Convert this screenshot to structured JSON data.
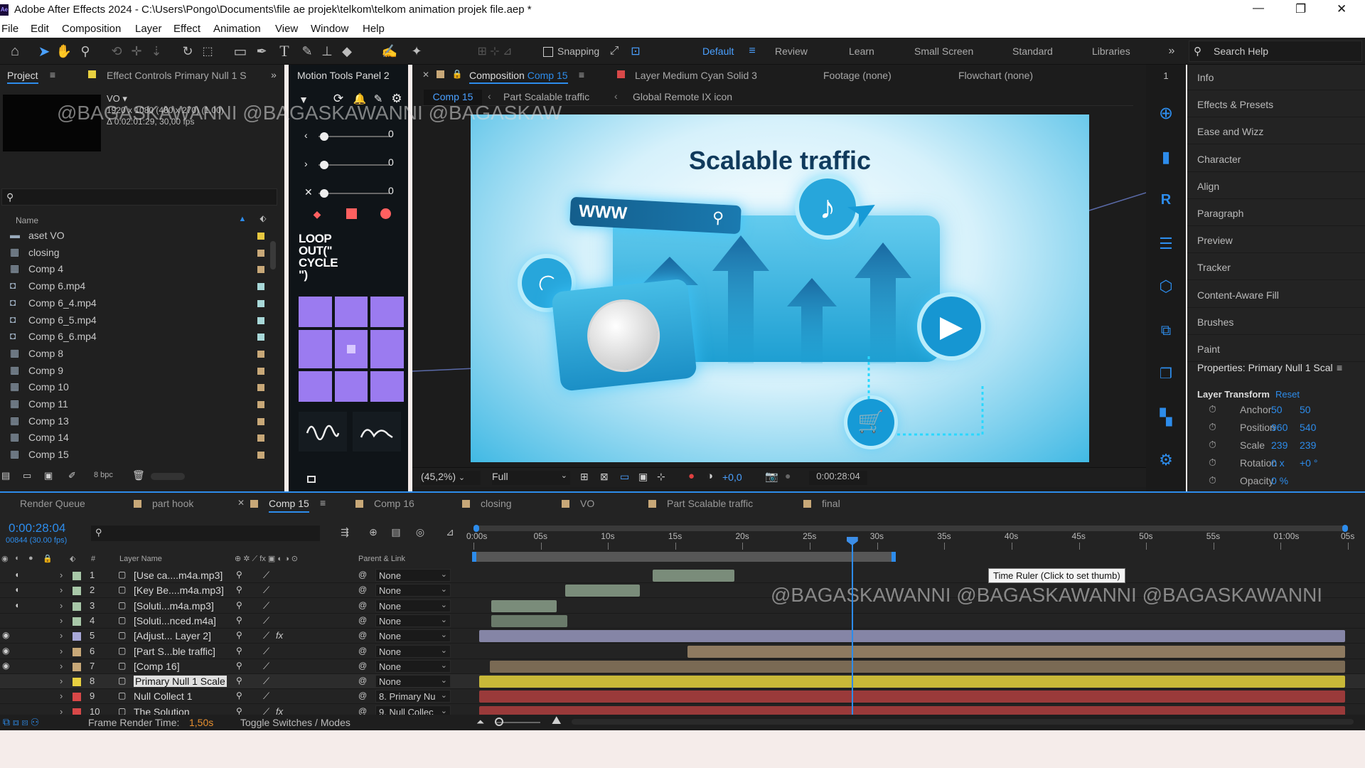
{
  "window": {
    "title": "Adobe After Effects 2024 - C:\\Users\\Pongo\\Documents\\file ae projek\\telkom\\telkom animation projek file.aep *",
    "minimize": "—",
    "maximize": "❐",
    "close": "✕",
    "app_badge": "Ae"
  },
  "menu": [
    "File",
    "Edit",
    "Composition",
    "Layer",
    "Effect",
    "Animation",
    "View",
    "Window",
    "Help"
  ],
  "toolbar": {
    "snapping": "Snapping",
    "workspaces": [
      "Default",
      "Review",
      "Learn",
      "Small Screen",
      "Standard",
      "Libraries"
    ],
    "search_placeholder": "Search Help"
  },
  "project": {
    "tab": "Project",
    "tab2": "Effect Controls Primary Null 1 S",
    "item_name": "VO ▾",
    "item_info1": "1920 x 1080  (480 x 270) (1,00)",
    "item_info2": "Δ 0:02:01:29, 30,00 fps",
    "search_placeholder": "",
    "col_name": "Name",
    "items": [
      {
        "name": "aset VO",
        "type": "folder",
        "color": "#e8c840"
      },
      {
        "name": "closing",
        "type": "comp",
        "color": "#c8a878"
      },
      {
        "name": "Comp 4",
        "type": "comp",
        "color": "#c8a878"
      },
      {
        "name": "Comp 6.mp4",
        "type": "video",
        "color": "#a8d8d8"
      },
      {
        "name": "Comp 6_4.mp4",
        "type": "video",
        "color": "#a8d8d8"
      },
      {
        "name": "Comp 6_5.mp4",
        "type": "video",
        "color": "#a8d8d8"
      },
      {
        "name": "Comp 6_6.mp4",
        "type": "video",
        "color": "#a8d8d8"
      },
      {
        "name": "Comp 8",
        "type": "comp",
        "color": "#c8a878"
      },
      {
        "name": "Comp 9",
        "type": "comp",
        "color": "#c8a878"
      },
      {
        "name": "Comp 10",
        "type": "comp",
        "color": "#c8a878"
      },
      {
        "name": "Comp 11",
        "type": "comp",
        "color": "#c8a878"
      },
      {
        "name": "Comp 13",
        "type": "comp",
        "color": "#c8a878"
      },
      {
        "name": "Comp 14",
        "type": "comp",
        "color": "#c8a878"
      },
      {
        "name": "Comp 15",
        "type": "comp",
        "color": "#c8a878"
      }
    ],
    "bpc": "8 bpc"
  },
  "motion_tools": {
    "tab": "Motion Tools Panel 2",
    "vals": [
      "0",
      "0",
      "0"
    ],
    "loop_text": "LOOP OUT(\" CYCLE \")"
  },
  "comp_viewer": {
    "tab": "Composition",
    "tab_comp": "Comp 15",
    "layer_tab": "Layer  Medium Cyan Solid 3",
    "footage_tab": "Footage  (none)",
    "flowchart_tab": "Flowchart  (none)",
    "breadcrumbs": [
      "Comp 15",
      "Part Scalable traffic",
      "Global Remote IX icon"
    ],
    "zoom": "(45,2%)",
    "quality": "Full",
    "exposure": "+0,0",
    "timecode": "0:00:28:04"
  },
  "art": {
    "title": "Scalable traffic",
    "url": "WWW"
  },
  "watermark": {
    "text1": "@BAGASKAWANNI @BAGASKAWANNI @BAGASKAW",
    "text2": "@BAGASKAWANNI @BAGASKAWANNI @BAGASKAWANNI"
  },
  "right_panels": [
    "Info",
    "Effects & Presets",
    "Ease and Wizz",
    "Character",
    "Align",
    "Paragraph",
    "Preview",
    "Tracker",
    "Content-Aware Fill",
    "Brushes",
    "Paint"
  ],
  "properties": {
    "title": "Properties: Primary Null 1 Scal",
    "layer_transform": "Layer Transform",
    "reset": "Reset",
    "rows": [
      {
        "label": "Anchor",
        "v1": "50",
        "v2": "50"
      },
      {
        "label": "Position",
        "v1": "960",
        "v2": "540"
      },
      {
        "label": "Scale",
        "v1": "239",
        "v2": "239"
      },
      {
        "label": "Rotation",
        "v1": "0 x",
        "v2": "+0 °"
      },
      {
        "label": "Opacity",
        "v1": "0 %",
        "v2": ""
      }
    ]
  },
  "timeline_tabs": [
    {
      "name": "Render Queue",
      "color": ""
    },
    {
      "name": "part hook",
      "color": "#c8a878"
    },
    {
      "name": "Comp 15",
      "color": "#c8a878"
    },
    {
      "name": "Comp 16",
      "color": "#c8a878"
    },
    {
      "name": "closing",
      "color": "#c8a878"
    },
    {
      "name": "VO",
      "color": "#c8a878"
    },
    {
      "name": "Part Scalable traffic",
      "color": "#c8a878"
    },
    {
      "name": "final",
      "color": "#c8a878"
    }
  ],
  "timeline": {
    "timecode": "0:00:28:04",
    "frames": "00844 (30.00 fps)",
    "col_layer": "Layer Name",
    "col_parent": "Parent & Link",
    "tooltip": "Time Ruler (Click to set thumb)",
    "ruler": [
      "0:00s",
      "05s",
      "10s",
      "15s",
      "20s",
      "25s",
      "30s",
      "35s",
      "40s",
      "45s",
      "50s",
      "55s",
      "01:00s",
      "05s"
    ],
    "playhead_sec": 28.1,
    "ruler_end_sec": 65,
    "layers": [
      {
        "n": "1",
        "name": "[Use ca....m4a.mp3]",
        "color": "#a8c8a8",
        "parent": "None",
        "fx": false,
        "start": 12.9,
        "end": 19.6,
        "bar": "#7a8c7a"
      },
      {
        "n": "2",
        "name": "[Key Be....m4a.mp3]",
        "color": "#a8c8a8",
        "parent": "None",
        "fx": false,
        "start": 6.4,
        "end": 12.6,
        "bar": "#7a8c7a"
      },
      {
        "n": "3",
        "name": "[Soluti...m4a.mp3]",
        "color": "#a8c8a8",
        "parent": "None",
        "fx": false,
        "start": 0.9,
        "end": 6.4,
        "bar": "#7a8c7a"
      },
      {
        "n": "4",
        "name": "[Soluti...nced.m4a]",
        "color": "#a8c8a8",
        "parent": "None",
        "fx": false,
        "start": 0.9,
        "end": 7.2,
        "bar": "#6a7a6a"
      },
      {
        "n": "5",
        "name": "[Adjust... Layer 2]",
        "color": "#a8a8d8",
        "parent": "None",
        "fx": true,
        "start": 0,
        "end": 65,
        "bar": "#8585a6"
      },
      {
        "n": "6",
        "name": "[Part S...ble traffic]",
        "color": "#c8a878",
        "parent": "None",
        "fx": false,
        "start": 15.5,
        "end": 65,
        "bar": "#8e7a60"
      },
      {
        "n": "7",
        "name": "[Comp 16]",
        "color": "#c8a878",
        "parent": "None",
        "fx": false,
        "start": 0.8,
        "end": 65,
        "bar": "#7a6a54"
      },
      {
        "n": "8",
        "name": "Primary Null 1 Scale",
        "color": "#e8d040",
        "parent": "None",
        "fx": false,
        "start": 0,
        "end": 65,
        "bar": "#c8b838"
      },
      {
        "n": "9",
        "name": "Null Collect  1",
        "color": "#d84848",
        "parent": "8. Primary Nu",
        "fx": false,
        "start": 0,
        "end": 65,
        "bar": "#9a3a3a"
      },
      {
        "n": "10",
        "name": "The Solution",
        "color": "#d84848",
        "parent": "9. Null Collec",
        "fx": true,
        "start": 0,
        "end": 65,
        "bar": "#9a3a3a"
      }
    ],
    "frame_render_label": "Frame Render Time:",
    "frame_render_value": "1,50s",
    "toggle": "Toggle Switches / Modes"
  }
}
